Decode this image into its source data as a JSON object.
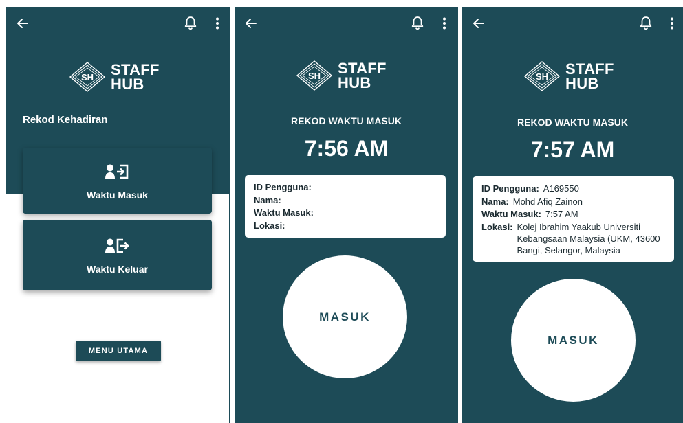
{
  "colors": {
    "primary": "#1d4b57",
    "surface": "#ffffff",
    "text_dark": "#1b2a30"
  },
  "icons": {
    "back": "arrow-left-icon",
    "notification": "bell-icon",
    "more": "kebab-icon",
    "clock_in": "user-sign-in-icon",
    "clock_out": "user-sign-out-icon"
  },
  "logo": {
    "monogram": "SH",
    "line1": "STAFF",
    "line2": "HUB"
  },
  "screen1": {
    "title": "Rekod Kehadiran",
    "clock_in_label": "Waktu Masuk",
    "clock_out_label": "Waktu Keluar",
    "menu_label": "MENU UTAMA"
  },
  "screen2": {
    "title": "REKOD WAKTU MASUK",
    "time": "7:56 AM",
    "labels": {
      "user_id": "ID Pengguna:",
      "name": "Nama:",
      "time_in": "Waktu Masuk:",
      "location": "Lokasi:"
    },
    "values": {
      "user_id": "",
      "name": "",
      "time_in": "",
      "location": ""
    },
    "button": "MASUK"
  },
  "screen3": {
    "title": "REKOD WAKTU MASUK",
    "time": "7:57 AM",
    "labels": {
      "user_id": "ID Pengguna:",
      "name": "Nama:",
      "time_in": "Waktu Masuk:",
      "location": "Lokasi:"
    },
    "values": {
      "user_id": "A169550",
      "name": "Mohd Afiq Zainon",
      "time_in": "7:57 AM",
      "location": "Kolej Ibrahim Yaakub Universiti Kebangsaan Malaysia (UKM, 43600 Bangi, Selangor, Malaysia"
    },
    "button": "MASUK"
  }
}
